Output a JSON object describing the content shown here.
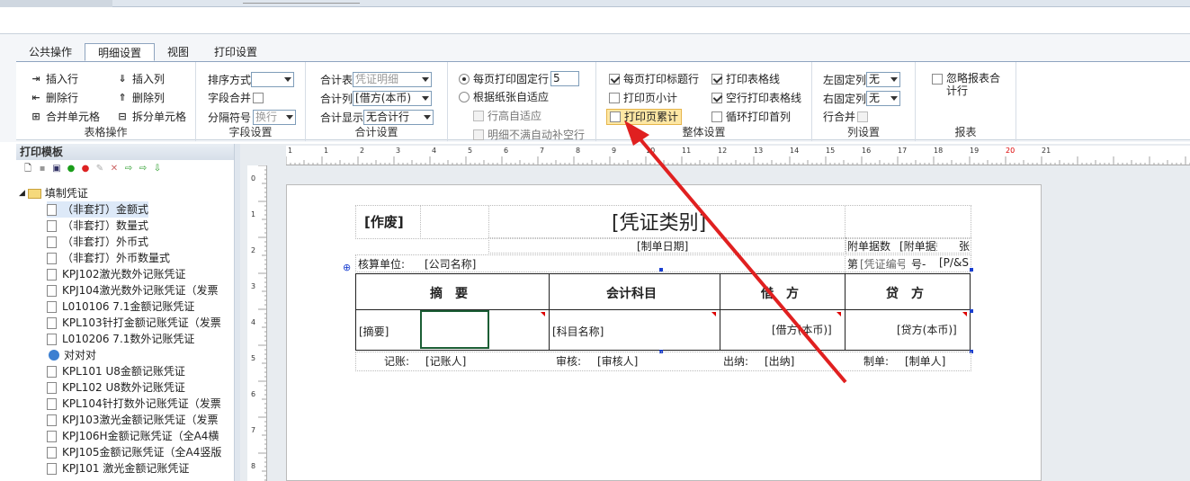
{
  "tabs": [
    "公共操作",
    "明细设置",
    "视图",
    "打印设置"
  ],
  "active_tab": "明细设置",
  "table_ops": {
    "items": [
      "插入行",
      "插入列",
      "删除行",
      "删除列",
      "合并单元格",
      "拆分单元格"
    ],
    "title": "表格操作"
  },
  "field_settings": {
    "sort_label": "排序方式",
    "sort_value": "",
    "merge_label": "字段合并",
    "sep_label": "分隔符号",
    "sep_value": "换行",
    "title": "字段设置"
  },
  "total_settings": {
    "table_label": "合计表",
    "table_value": "凭证明细",
    "col_label": "合计列",
    "col_value": "[借方(本币)",
    "show_label": "合计显示",
    "show_value": "无合计行",
    "title": "合计设置"
  },
  "rows_settings": {
    "fixed_label": "每页打印固定行",
    "fixed_value": "5",
    "adapt_label": "根据纸张自适应",
    "rowh_label": "行高自适应",
    "fill_label": "明细不满自动补空行"
  },
  "overall": {
    "items": [
      "每页打印标题行",
      "打印表格线",
      "打印页小计",
      "空行打印表格线",
      "打印页累计",
      "循环打印首列"
    ],
    "title": "整体设置"
  },
  "col_settings": {
    "left_label": "左固定列",
    "left_value": "无",
    "right_label": "右固定列",
    "right_value": "无",
    "merge_label": "行合并",
    "title": "列设置"
  },
  "report": {
    "ignore_label": "忽略报表合计行",
    "title": "报表"
  },
  "left_panel": {
    "title": "打印模板"
  },
  "tree": {
    "root": "填制凭证",
    "items": [
      "（非套打）金额式",
      "（非套打）数量式",
      "（非套打）外币式",
      "（非套打）外币数量式",
      "KPJ102激光数外记账凭证",
      "KPJ104激光数外记账凭证（发票",
      "L010106 7.1金额记账凭证",
      "KPL103针打金额记账凭证（发票",
      "L010206 7.1数外记账凭证",
      "对对对",
      "KPL101 U8金额记账凭证",
      "KPL102 U8数外记账凭证",
      "KPL104针打数外记账凭证（发票",
      "KPJ103激光金额记账凭证（发票",
      "KPJ106H金额记账凭证（全A4横",
      "KPJ105金额记账凭证（全A4竖版",
      "KPJ101 激光金额记账凭证"
    ]
  },
  "ruler": {
    "h": [
      "1",
      "1",
      "2",
      "3",
      "4",
      "5",
      "6",
      "7",
      "8",
      "9",
      "10",
      "11",
      "12",
      "13",
      "14",
      "15",
      "16",
      "17",
      "18",
      "19",
      "20",
      "21"
    ],
    "v": [
      "0",
      "1",
      "2",
      "3",
      "4",
      "5",
      "6",
      "7",
      "8"
    ]
  },
  "voucher": {
    "void": "[作废]",
    "type": "[凭证类别]",
    "date": "[制单日期]",
    "attach_a": "附单据数",
    "attach_b": "[附单据数",
    "attach_c": "张",
    "unit_label": "核算单位:",
    "unit_value": "[公司名称]",
    "no_a": "第",
    "no_b": "[凭证编号]",
    "no_c": "号-",
    "no_d": "[P/&S",
    "h_summary": "摘　要",
    "h_account": "会计科目",
    "h_debit": "借　方",
    "h_credit": "贷　方",
    "summary": "[摘要]",
    "account": "[科目名称]",
    "debit": "[借方(本币)]",
    "credit": "[贷方(本币)]",
    "book_l": "记账:",
    "book_v": "[记账人]",
    "audit_l": "审核:",
    "audit_v": "[审核人]",
    "cash_l": "出纳:",
    "cash_v": "[出纳]",
    "maker_l": "制单:",
    "maker_v": "[制单人]"
  }
}
